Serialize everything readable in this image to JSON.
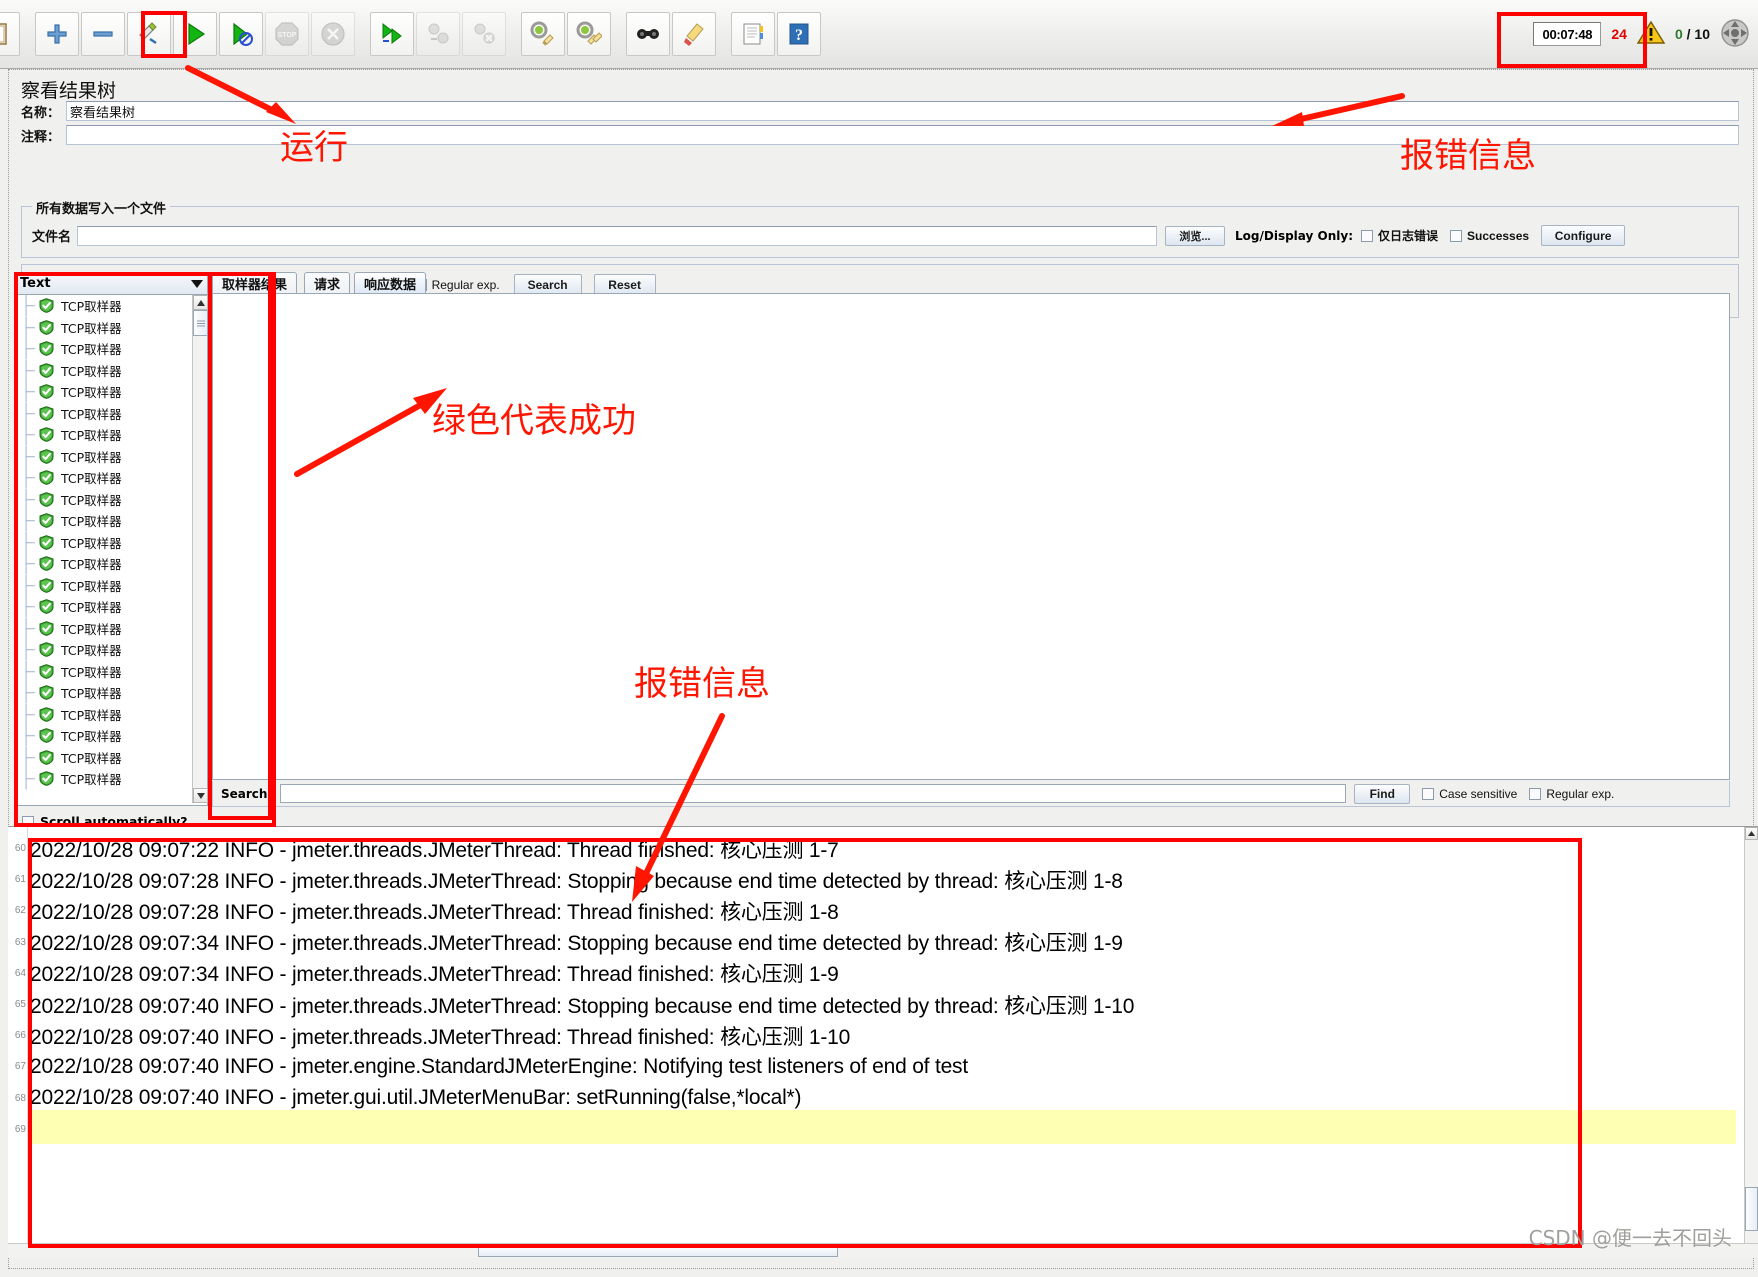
{
  "toolbar": {
    "buttons": [
      {
        "name": "new-icon",
        "label": "New"
      },
      {
        "name": "add-icon",
        "label": "Add"
      },
      {
        "name": "remove-icon",
        "label": "Remove"
      },
      {
        "name": "save-icon",
        "label": "Save"
      },
      {
        "name": "start-icon",
        "label": "Start"
      },
      {
        "name": "start-no-timers-icon",
        "label": "Start no pauses"
      },
      {
        "name": "stop-icon",
        "label": "Stop"
      },
      {
        "name": "shutdown-icon",
        "label": "Shutdown"
      },
      {
        "name": "start-remote-all-icon",
        "label": "Remote Start All"
      },
      {
        "name": "stop-remote-all-icon",
        "label": "Remote Stop All"
      },
      {
        "name": "shutdown-remote-all-icon",
        "label": "Remote Shutdown All"
      },
      {
        "name": "clear-icon",
        "label": "Clear"
      },
      {
        "name": "clear-all-icon",
        "label": "Clear All"
      },
      {
        "name": "search-icon",
        "label": "Search"
      },
      {
        "name": "search-reset-icon",
        "label": "Reset Search"
      },
      {
        "name": "function-helper-icon",
        "label": "Function Helper Dialog"
      },
      {
        "name": "help-icon",
        "label": "Help"
      }
    ],
    "status": {
      "timer": "00:07:48",
      "error_count": "24",
      "warning_icon": "warning-triangle-icon",
      "active_threads": "0",
      "total_threads_label": "/ 10",
      "expand_icon": "expand-icon"
    }
  },
  "panel": {
    "title": "察看结果树",
    "name_label": "名称：",
    "name_value": "察看结果树",
    "comment_label": "注释：",
    "comment_value": "",
    "file_group_title": "所有数据写入一个文件",
    "filename_label": "文件名",
    "filename_value": "",
    "browse_button": "浏览...",
    "log_display_only_label": "Log/Display Only:",
    "errors_only_checkbox": "仅日志错误",
    "successes_checkbox": "Successes",
    "configure_button": "Configure"
  },
  "search_bar": {
    "label": "Search:",
    "value": "",
    "case_sensitive": "Case sensitive",
    "regular_exp": "Regular exp.",
    "search_button": "Search",
    "reset_button": "Reset"
  },
  "tree": {
    "renderer_selected": "Text",
    "dropdown_icon": "chevron-down-icon",
    "item_label": "TCP取样器",
    "item_icon": "green-shield-check-icon",
    "item_count": 23,
    "scroll_auto_label": "Scroll automatically?",
    "items": [
      "TCP取样器",
      "TCP取样器",
      "TCP取样器",
      "TCP取样器",
      "TCP取样器",
      "TCP取样器",
      "TCP取样器",
      "TCP取样器",
      "TCP取样器",
      "TCP取样器",
      "TCP取样器",
      "TCP取样器",
      "TCP取样器",
      "TCP取样器",
      "TCP取样器",
      "TCP取样器",
      "TCP取样器",
      "TCP取样器",
      "TCP取样器",
      "TCP取样器",
      "TCP取样器",
      "TCP取样器",
      "TCP取样器"
    ]
  },
  "tabs": [
    {
      "label": "取样器结果",
      "selected": false
    },
    {
      "label": "请求",
      "selected": false
    },
    {
      "label": "响应数据",
      "selected": true
    }
  ],
  "response_panel": {
    "content": "",
    "search_label": "Search:",
    "search_value": "",
    "find_button": "Find",
    "case_sensitive": "Case sensitive",
    "regular_exp": "Regular exp."
  },
  "log": {
    "lines": [
      {
        "num": "60",
        "text": "2022/10/28 09:07:22 INFO  - jmeter.threads.JMeterThread: Thread finished: 核心压测 1-7"
      },
      {
        "num": "61",
        "text": "2022/10/28 09:07:28 INFO  - jmeter.threads.JMeterThread: Stopping because end time detected by thread: 核心压测 1-8"
      },
      {
        "num": "62",
        "text": "2022/10/28 09:07:28 INFO  - jmeter.threads.JMeterThread: Thread finished: 核心压测 1-8"
      },
      {
        "num": "63",
        "text": "2022/10/28 09:07:34 INFO  - jmeter.threads.JMeterThread: Stopping because end time detected by thread: 核心压测 1-9"
      },
      {
        "num": "64",
        "text": "2022/10/28 09:07:34 INFO  - jmeter.threads.JMeterThread: Thread finished: 核心压测 1-9"
      },
      {
        "num": "65",
        "text": "2022/10/28 09:07:40 INFO  - jmeter.threads.JMeterThread: Stopping because end time detected by thread: 核心压测 1-10"
      },
      {
        "num": "66",
        "text": "2022/10/28 09:07:40 INFO  - jmeter.threads.JMeterThread: Thread finished: 核心压测 1-10"
      },
      {
        "num": "67",
        "text": "2022/10/28 09:07:40 INFO  - jmeter.engine.StandardJMeterEngine: Notifying test listeners of end of test"
      },
      {
        "num": "68",
        "text": "2022/10/28 09:07:40 INFO  - jmeter.gui.util.JMeterMenuBar: setRunning(false,*local*)"
      },
      {
        "num": "69",
        "text": ""
      }
    ]
  },
  "annotations": [
    {
      "id": "run",
      "text": "运行"
    },
    {
      "id": "error-top",
      "text": "报错信息"
    },
    {
      "id": "green-success",
      "text": "绿色代表成功"
    },
    {
      "id": "error-log",
      "text": "报错信息"
    }
  ],
  "watermark": "CSDN @便一去不回头",
  "colors": {
    "annotation_red": "#ff1500",
    "highlight_box": "#ff0000",
    "success_green": "#3fa535",
    "error_red": "#e00000",
    "warning_yellow": "#f5c518",
    "log_highlight": "#ffffb4"
  }
}
